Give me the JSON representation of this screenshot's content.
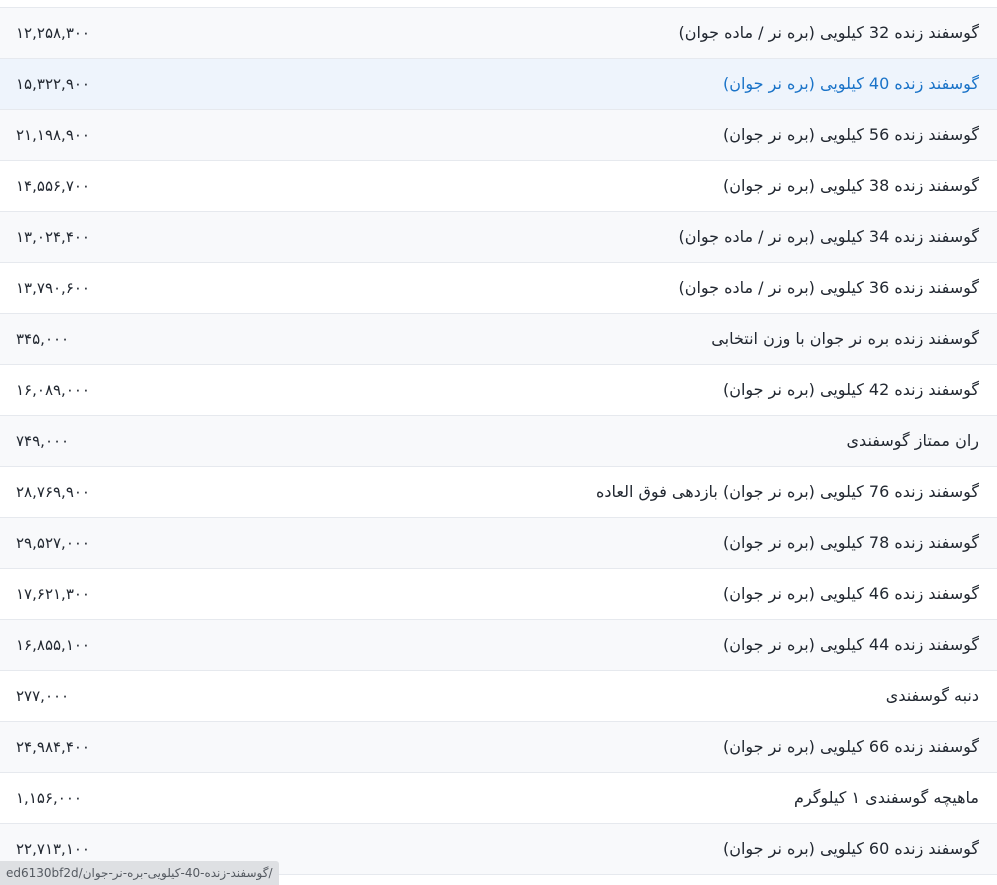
{
  "products": [
    {
      "name": "گوسفند زنده 32 کیلویی (بره نر / ماده جوان)",
      "price": "۱۲,۲۵۸,۳۰۰"
    },
    {
      "name": "گوسفند زنده 40 کیلویی (بره نر جوان)",
      "price": "۱۵,۳۲۲,۹۰۰"
    },
    {
      "name": "گوسفند زنده 56 کیلویی (بره نر جوان)",
      "price": "۲۱,۱۹۸,۹۰۰"
    },
    {
      "name": "گوسفند زنده 38 کیلویی (بره نر جوان)",
      "price": "۱۴,۵۵۶,۷۰۰"
    },
    {
      "name": "گوسفند زنده 34 کیلویی (بره نر / ماده جوان)",
      "price": "۱۳,۰۲۴,۴۰۰"
    },
    {
      "name": "گوسفند زنده 36 کیلویی (بره نر / ماده جوان)",
      "price": "۱۳,۷۹۰,۶۰۰"
    },
    {
      "name": "گوسفند زنده بره نر جوان با وزن انتخابی",
      "price": "۳۴۵,۰۰۰"
    },
    {
      "name": "گوسفند زنده 42 کیلویی (بره نر جوان)",
      "price": "۱۶,۰۸۹,۰۰۰"
    },
    {
      "name": "ران ممتاز گوسفندی",
      "price": "۷۴۹,۰۰۰"
    },
    {
      "name": "گوسفند زنده 76 کیلویی (بره نر جوان) بازدهی فوق العاده",
      "price": "۲۸,۷۶۹,۹۰۰"
    },
    {
      "name": "گوسفند زنده 78 کیلویی (بره نر جوان)",
      "price": "۲۹,۵۲۷,۰۰۰"
    },
    {
      "name": "گوسفند زنده 46 کیلویی (بره نر جوان)",
      "price": "۱۷,۶۲۱,۳۰۰"
    },
    {
      "name": "گوسفند زنده 44 کیلویی (بره نر جوان)",
      "price": "۱۶,۸۵۵,۱۰۰"
    },
    {
      "name": "دنبه گوسفندی",
      "price": "۲۷۷,۰۰۰"
    },
    {
      "name": "گوسفند زنده 66 کیلویی (بره نر جوان)",
      "price": "۲۴,۹۸۴,۴۰۰"
    },
    {
      "name": "ماهیچه گوسفندی ۱ کیلوگرم",
      "price": "۱,۱۵۶,۰۰۰"
    },
    {
      "name": "گوسفند زنده 60 کیلویی (بره نر جوان)",
      "price": "۲۲,۷۱۳,۱۰۰"
    }
  ],
  "hovered_index": 1,
  "status_bar": {
    "url": "ed6130bf2d/گوسفند-زنده-40-کیلویی-بره-نر-جوان/"
  },
  "colors": {
    "hover_text": "#1a73c8",
    "hover_row": "#eef4fc",
    "alt_row": "#f8f9fb",
    "border": "#e6e9ee"
  }
}
